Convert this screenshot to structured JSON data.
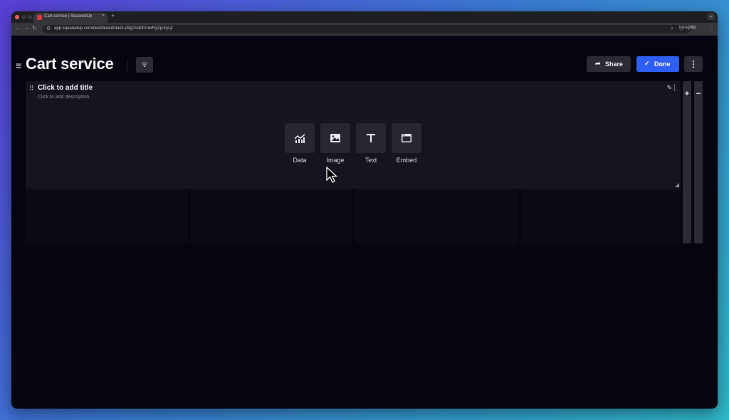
{
  "browser": {
    "tab_title": "Cart service | SquaredUp",
    "tab_close": "×",
    "new_tab": "+",
    "url": "app.squaredup.com/dashboard/dash-d3g2Vq0CmwFljiZjcXyLjt",
    "incognito_label": "Incognito"
  },
  "header": {
    "title": "Cart service",
    "share_label": "Share",
    "done_label": "Done"
  },
  "tile": {
    "title": "Click to add title",
    "description": "Click to add description",
    "options": [
      {
        "label": "Data",
        "icon": "chart-icon"
      },
      {
        "label": "Image",
        "icon": "image-icon"
      },
      {
        "label": "Text",
        "icon": "text-icon"
      },
      {
        "label": "Embed",
        "icon": "embed-icon"
      }
    ]
  },
  "zoom": {
    "plus": "+",
    "minus": "−"
  },
  "colors": {
    "accent": "#2f5ff5",
    "background": "#05050f",
    "tile": "#15151f"
  }
}
